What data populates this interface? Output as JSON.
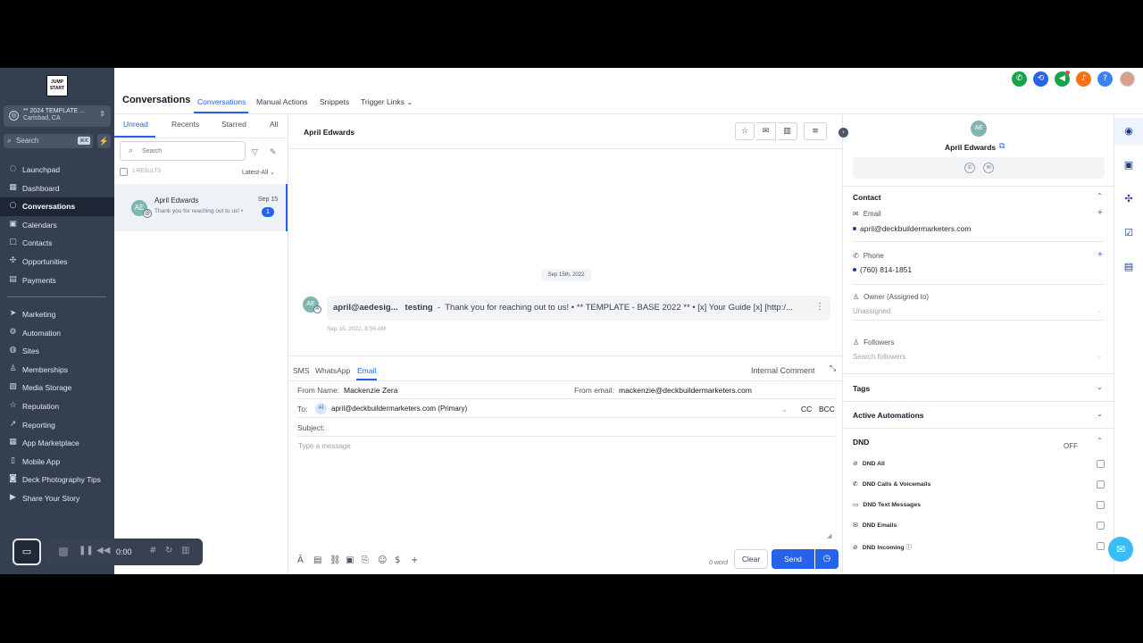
{
  "sidebar": {
    "logo_text": "JUMP START",
    "location": {
      "name": "** 2024 TEMPLATE ...",
      "city": "Carlsbad, CA"
    },
    "search_placeholder": "Search",
    "search_shortcut": "⌘K",
    "items": [
      {
        "label": "Launchpad",
        "icon": "rocket-icon"
      },
      {
        "label": "Dashboard",
        "icon": "grid-icon"
      },
      {
        "label": "Conversations",
        "icon": "chat-icon",
        "active": true
      },
      {
        "label": "Calendars",
        "icon": "calendar-icon"
      },
      {
        "label": "Contacts",
        "icon": "contacts-icon"
      },
      {
        "label": "Opportunities",
        "icon": "opportunities-icon"
      },
      {
        "label": "Payments",
        "icon": "payments-icon"
      }
    ],
    "items2": [
      {
        "label": "Marketing",
        "icon": "marketing-icon"
      },
      {
        "label": "Automation",
        "icon": "automation-icon"
      },
      {
        "label": "Sites",
        "icon": "globe-icon"
      },
      {
        "label": "Memberships",
        "icon": "membership-icon"
      },
      {
        "label": "Media Storage",
        "icon": "media-icon"
      },
      {
        "label": "Reputation",
        "icon": "star-icon"
      },
      {
        "label": "Reporting",
        "icon": "chart-icon"
      },
      {
        "label": "App Marketplace",
        "icon": "apps-icon"
      },
      {
        "label": "Mobile App",
        "icon": "mobile-icon"
      },
      {
        "label": "Deck Photography Tips",
        "icon": "camera-icon"
      },
      {
        "label": "Share Your Story",
        "icon": "video-icon"
      }
    ]
  },
  "recorder": {
    "time": "0:00"
  },
  "header": {
    "title": "Conversations",
    "tabs": [
      "Conversations",
      "Manual Actions",
      "Snippets",
      "Trigger Links"
    ],
    "icon_colors": {
      "phone": "#16a34a",
      "sync": "#2563eb",
      "megaphone": "#16a34a",
      "bell": "#f97316",
      "help": "#3b82f6"
    }
  },
  "list": {
    "tabs": [
      "Unread",
      "Recents",
      "Starred",
      "All"
    ],
    "search_placeholder": "Search",
    "results": "1 RESULTS",
    "sort": "Latest-All",
    "conversations": [
      {
        "initials": "AE",
        "name": "April Edwards",
        "preview": "Thank you for reaching out to us! •",
        "date": "Sep 15",
        "badge": "1"
      }
    ]
  },
  "chat": {
    "contact_name": "April Edwards",
    "date_divider": "Sep 15th, 2022",
    "message": {
      "initials": "AE",
      "sender": "april@aedesig...",
      "subject": "testing",
      "separator": "-",
      "body": "Thank you for reaching out to us! • ** TEMPLATE - BASE 2022 ** • [x] Your Guide [x] [http:/...",
      "timestamp": "Sep 15, 2022, 8:56 AM"
    },
    "compose": {
      "tabs": [
        "SMS",
        "WhatsApp",
        "Email"
      ],
      "internal_comment": "Internal Comment",
      "from_name_label": "From Name:",
      "from_name": "Mackenzie Zera",
      "from_email_label": "From email:",
      "from_email": "mackenzie@deckbuildermarketers.com",
      "to_label": "To:",
      "to_initials": "AI",
      "to_value": "april@deckbuildermarketers.com (Primary)",
      "cc": "CC",
      "bcc": "BCC",
      "subject_label": "Subject:",
      "message_placeholder": "Type a message",
      "word_count": "0 word",
      "clear": "Clear",
      "send": "Send"
    }
  },
  "contact": {
    "initials": "AE",
    "name": "April Edwards",
    "contact_section": "Contact",
    "email_label": "Email",
    "email": "april@deckbuildermarketers.com",
    "phone_label": "Phone",
    "phone": "(760) 814-1851",
    "owner_label": "Owner (Assigned to)",
    "owner_value": "Unassigned",
    "followers_label": "Followers",
    "followers_placeholder": "Search followers",
    "tags": "Tags",
    "active_automations": "Active Automations",
    "dnd": "DND",
    "dnd_status": "OFF",
    "dnd_items": [
      "DND All",
      "DND Calls & Voicemails",
      "DND Text Messages",
      "DND Emails",
      "DND Incoming"
    ]
  }
}
